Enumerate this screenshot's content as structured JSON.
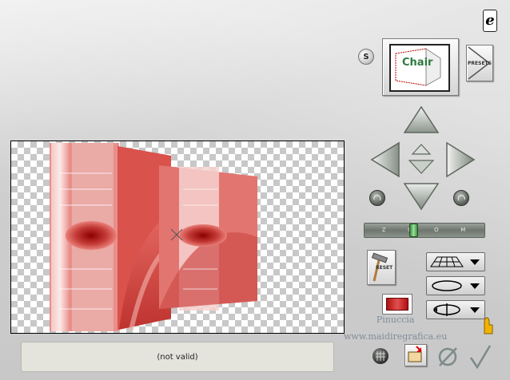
{
  "status": {
    "text": "(not valid)"
  },
  "presets": {
    "label": "PRESETS",
    "thumbnail_text": "Chair"
  },
  "reset": {
    "label": "RESET"
  },
  "zoom": {
    "label": "ZOOM",
    "value_fraction": 0.4
  },
  "watermark": {
    "line1": "Pinuccia",
    "line2": "www.maidiregrafica.eu"
  },
  "colors": {
    "accent_green": "#3d8a3d",
    "preview_red": "#d8655f",
    "panel_bg": "#d0d0d0"
  },
  "icons": [
    "help-icon",
    "s-icon",
    "arrow-up-icon",
    "arrow-down-icon",
    "arrow-left-icon",
    "arrow-right-icon",
    "small-up-icon",
    "small-down-icon",
    "rotate-left-icon",
    "rotate-right-icon",
    "reset-hammer-icon",
    "plane-grid-icon",
    "ellipse-icon",
    "rotation-icon",
    "grid-toggle-icon",
    "open-folder-icon",
    "cancel-icon",
    "ok-check-icon",
    "hand-icon"
  ]
}
